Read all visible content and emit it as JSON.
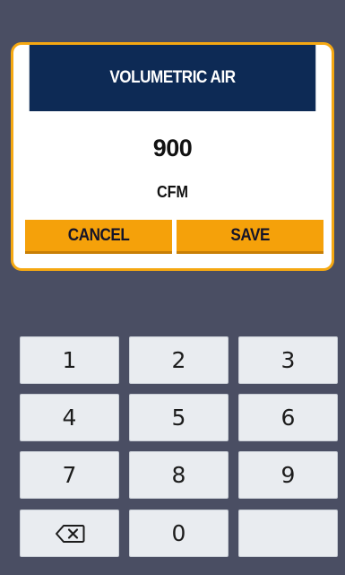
{
  "dialog": {
    "title": "VOLUMETRIC AIR",
    "value": "900",
    "unit": "CFM",
    "cancel_label": "CANCEL",
    "save_label": "SAVE"
  },
  "keypad": {
    "keys": [
      "1",
      "2",
      "3",
      "4",
      "5",
      "6",
      "7",
      "8",
      "9",
      "",
      "0",
      ""
    ],
    "backspace_icon": "backspace-icon"
  },
  "colors": {
    "background": "#4a4e63",
    "header": "#0d2a55",
    "accent": "#f5a10a",
    "key": "#e9ecf0"
  }
}
